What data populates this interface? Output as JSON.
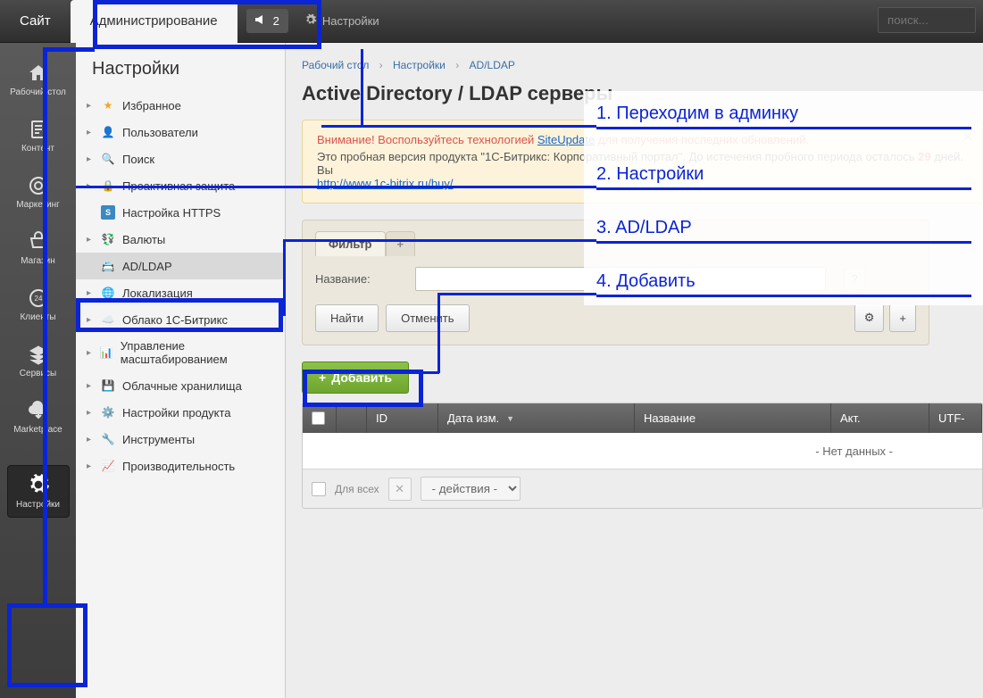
{
  "topbar": {
    "tab_site": "Сайт",
    "tab_admin": "Администрирование",
    "indicator_count": "2",
    "settings": "Настройки",
    "search_placeholder": "поиск..."
  },
  "rail": {
    "items": [
      {
        "label": "Рабочий стол"
      },
      {
        "label": "Контент"
      },
      {
        "label": "Маркетинг"
      },
      {
        "label": "Магазин"
      },
      {
        "label": "Клиенты"
      },
      {
        "label": "Сервисы"
      },
      {
        "label": "Marketplace"
      },
      {
        "label": "Настройки"
      }
    ]
  },
  "sidebar": {
    "heading": "Настройки",
    "items": [
      {
        "label": "Избранное",
        "icon": "star",
        "color": "#f5a623"
      },
      {
        "label": "Пользователи",
        "icon": "user",
        "color": "#6aa8dc"
      },
      {
        "label": "Поиск",
        "icon": "search",
        "color": "#6aa8dc"
      },
      {
        "label": "Проактивная защита",
        "icon": "shield",
        "color": "#f2b84b"
      },
      {
        "label": "Настройка HTTPS",
        "icon": "https",
        "color": "#3b88c3"
      },
      {
        "label": "Валюты",
        "icon": "currency",
        "color": "#888"
      },
      {
        "label": "AD/LDAP",
        "icon": "ldap",
        "color": "#3b88c3",
        "selected": true
      },
      {
        "label": "Локализация",
        "icon": "locale",
        "color": "#6aa8dc"
      },
      {
        "label": "Облако 1С-Битрикс",
        "icon": "cloud",
        "color": "#6aa8dc"
      },
      {
        "label": "Управление масштабированием",
        "icon": "scale",
        "color": "#888"
      },
      {
        "label": "Облачные хранилища",
        "icon": "storage",
        "color": "#6aa8dc"
      },
      {
        "label": "Настройки продукта",
        "icon": "gear",
        "color": "#888"
      },
      {
        "label": "Инструменты",
        "icon": "tools",
        "color": "#888"
      },
      {
        "label": "Производительность",
        "icon": "perf",
        "color": "#5fa84e"
      }
    ]
  },
  "breadcrumb": {
    "a": "Рабочий стол",
    "b": "Настройки",
    "c": "AD/LDAP"
  },
  "page_title": "Active Directory / LDAP серверы",
  "alert": {
    "line1_pre": "Внимание! Воспользуйтесь технологией ",
    "line1_link": "SiteUpdate",
    "line1_post": " для получения последних обновлений.",
    "line2_pre": "Это пробная версия продукта \"1С-Битрикс: Корпоративный портал\". До истечения пробного периода осталось ",
    "line2_days": "29",
    "line2_post": " дней. Вы",
    "buy_link": "http://www.1c-bitrix.ru/buy/"
  },
  "filter": {
    "tab_label": "Фильтр",
    "add_tab": "+",
    "name_label": "Название:",
    "find": "Найти",
    "cancel": "Отменить"
  },
  "add_button": "Добавить",
  "grid": {
    "cols": {
      "id": "ID",
      "date": "Дата изм.",
      "name": "Название",
      "act": "Акт.",
      "utf": "UTF-"
    },
    "no_data": "- Нет данных -",
    "for_all": "Для всех",
    "actions": "- действия -"
  },
  "annotations": {
    "a1": "1. Переходим в админку",
    "a2": "2. Настройки",
    "a3": "3. AD/LDAP",
    "a4": "4. Добавить"
  }
}
